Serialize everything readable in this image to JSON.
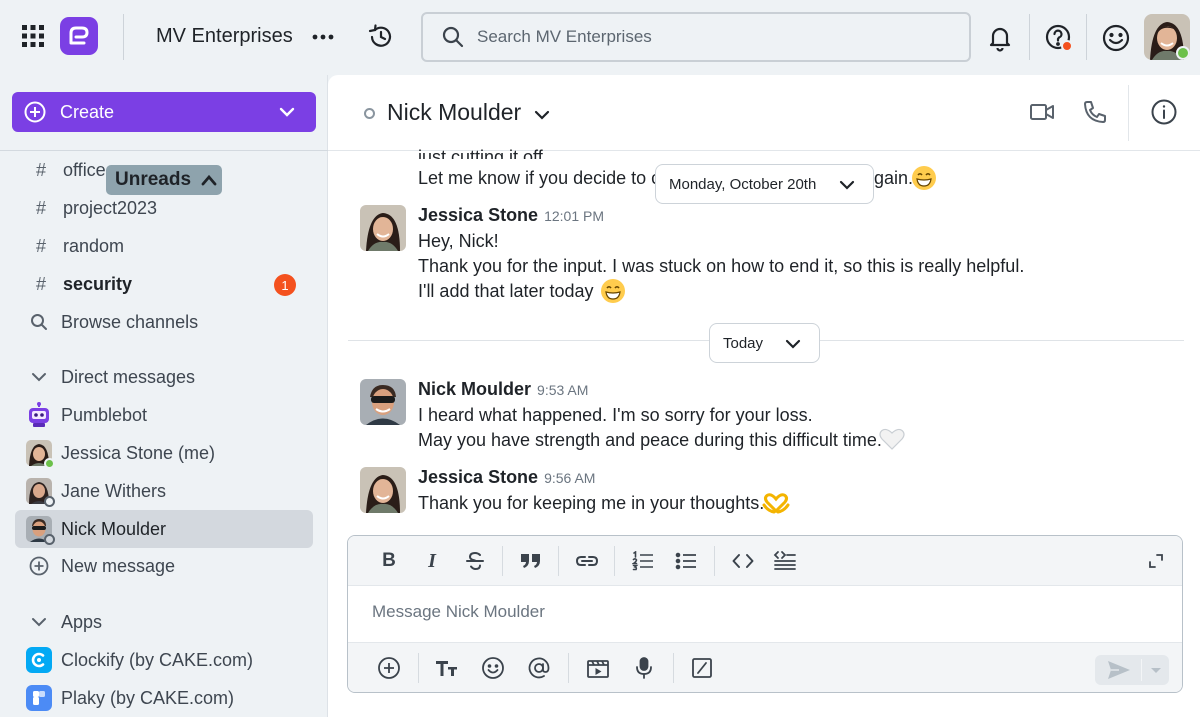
{
  "topbar": {
    "workspace_name": "MV Enterprises",
    "search_placeholder": "Search MV Enterprises"
  },
  "sidebar": {
    "create_label": "Create",
    "unreads_label": "Unreads",
    "channels": [
      {
        "label": "office",
        "bold": false
      },
      {
        "label": "project2023",
        "bold": false
      },
      {
        "label": "random",
        "bold": false
      },
      {
        "label": "security",
        "bold": true,
        "badge": "1"
      }
    ],
    "browse_channels": "Browse channels",
    "direct_messages_heading": "Direct messages",
    "dms": [
      {
        "label": "Pumblebot"
      },
      {
        "label": "Jessica Stone (me)"
      },
      {
        "label": "Jane Withers"
      },
      {
        "label": "Nick Moulder"
      }
    ],
    "new_message": "New message",
    "apps_heading": "Apps",
    "apps": [
      {
        "label": "Clockify (by CAKE.com)"
      },
      {
        "label": "Plaky (by CAKE.com)"
      }
    ]
  },
  "channel": {
    "name": "Nick Moulder"
  },
  "messages": {
    "earlier_line1": "just cutting it off.",
    "earlier_line2_a": "Let me know if you decide to c",
    "earlier_line2_b": "gain.",
    "date_pill_1": "Monday, October 20th",
    "msg1": {
      "author": "Jessica Stone",
      "time": "12:01 PM",
      "lines": [
        "Hey, Nick!",
        "Thank you for the input. I was stuck on how to end it, so this is really helpful.",
        "I'll add that  later today"
      ]
    },
    "date_pill_2": "Today",
    "msg2": {
      "author": "Nick Moulder",
      "time": "9:53 AM",
      "lines": [
        "I heard what happened. I'm so sorry for your loss.",
        "May you have strength and peace during this difficult time."
      ]
    },
    "msg3": {
      "author": "Jessica Stone",
      "time": "9:56 AM",
      "lines": [
        "Thank you for keeping me in your thoughts."
      ]
    }
  },
  "composer": {
    "placeholder": "Message Nick Moulder"
  },
  "colors": {
    "brand": "#7b3fe4",
    "badge": "#f4511e",
    "online": "#6cc04a"
  }
}
